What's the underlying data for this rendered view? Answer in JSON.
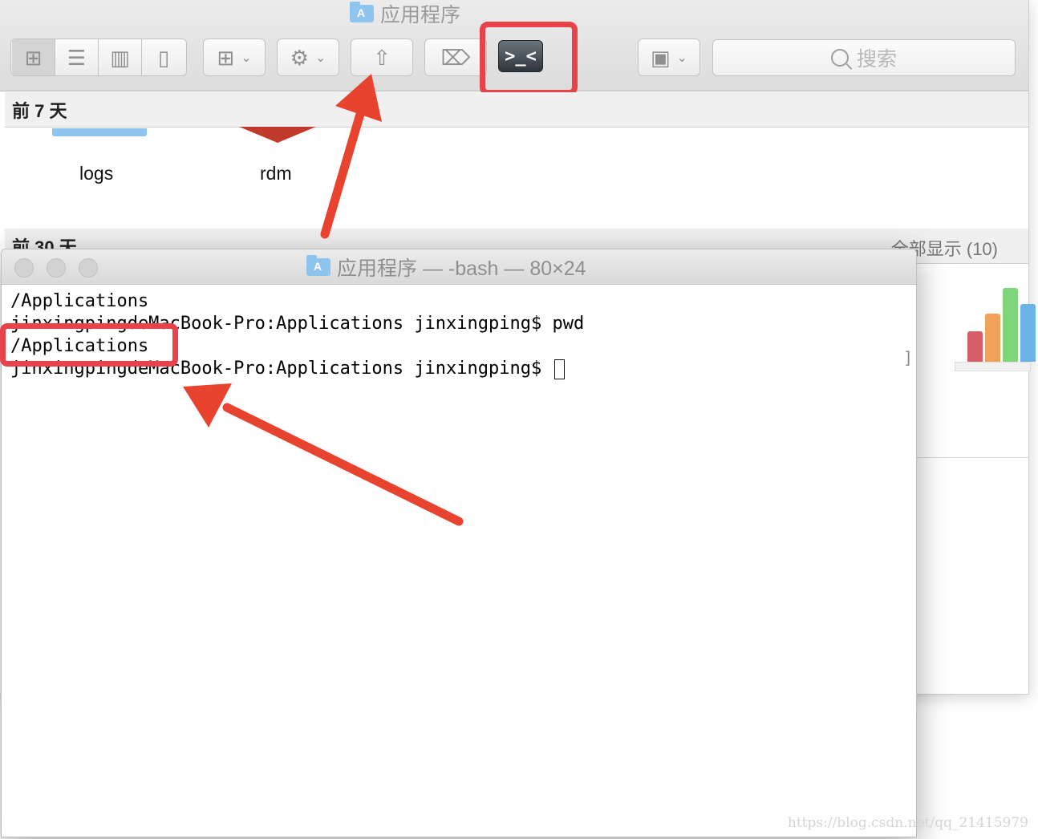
{
  "finder": {
    "title": "应用程序",
    "folder_glyph": "A",
    "toolbar": {
      "view_buttons": [
        "icon-view",
        "list-view",
        "column-view",
        "cover-flow-view"
      ],
      "active_view": "icon-view",
      "terminal_button_glyph": ">_<",
      "search_placeholder": "搜索"
    },
    "sections": [
      {
        "header": "前 7 天",
        "items": [
          "logs",
          "rdm"
        ]
      },
      {
        "header": "前 30 天",
        "show_all": "全部显示 (10)"
      }
    ]
  },
  "terminal": {
    "title": "应用程序 — -bash — 80×24",
    "lines": [
      "/Applications",
      "jinxingpingdeMacBook-Pro:Applications jinxingping$ pwd",
      "/Applications",
      "jinxingpingdeMacBook-Pro:Applications jinxingping$ "
    ],
    "scroll_bracket": "]"
  },
  "colors": {
    "annotation_red": "#e8434b",
    "arrow_red": "#e8432e",
    "folder_blue": "#8ec5ee"
  },
  "watermark": "https://blog.csdn.net/qq_21415979"
}
